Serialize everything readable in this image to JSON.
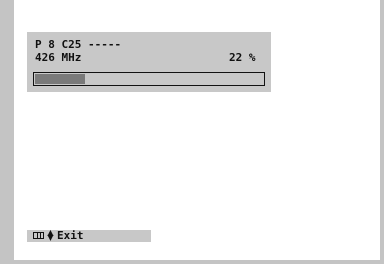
{
  "osd": {
    "program_line": "P 8 C25 -----",
    "frequency": "426 MHz",
    "percent": "22 %",
    "progress_fraction": 0.22
  },
  "help": {
    "menu_icon": "menu-grid-icon",
    "nav_icon": "up-down-arrow-icon",
    "exit_label": "Exit"
  },
  "colors": {
    "panel_bg": "#c8c8c8",
    "progress_fill": "#7a7a7a",
    "text": "#111111",
    "frame": "#c4c4c4"
  }
}
